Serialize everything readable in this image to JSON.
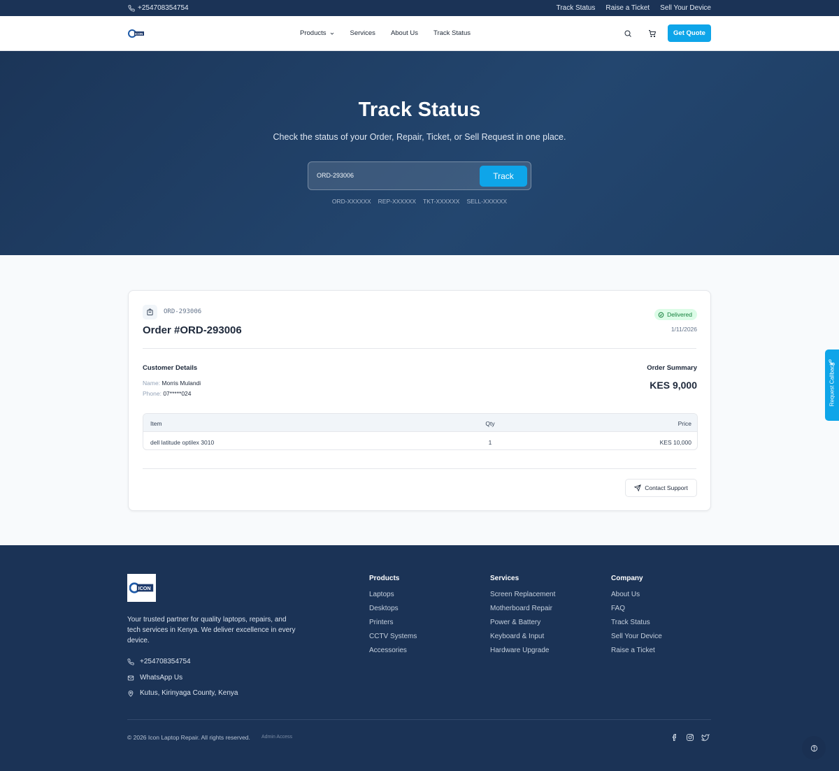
{
  "topbar": {
    "phone": "+254708354754",
    "links": [
      "Track Status",
      "Raise a Ticket",
      "Sell Your Device"
    ]
  },
  "nav": {
    "logo_text": "ICON",
    "menu": [
      "Products",
      "Services",
      "About Us",
      "Track Status"
    ],
    "cta": "Get Quote",
    "icons": [
      "search-icon",
      "cart-icon",
      "chevron-down-icon"
    ]
  },
  "hero": {
    "title": "Track Status",
    "subtitle": "Check the status of your Order, Repair, Ticket, or Sell Request in one place.",
    "input_value": "ORD-293006",
    "button": "Track",
    "formats": [
      "ORD-XXXXXX",
      "REP-XXXXXX",
      "TKT-XXXXXX",
      "SELL-XXXXXX"
    ]
  },
  "order": {
    "code": "ORD-293006",
    "title": "Order #ORD-293006",
    "status": "Delivered",
    "date": "1/11/2026",
    "customer_heading": "Customer Details",
    "name_label": "Name:",
    "name": "Morris Mulandi",
    "phone_label": "Phone:",
    "phone": "07*****024",
    "summary_heading": "Order Summary",
    "total": "KES 9,000",
    "table": {
      "headers": [
        "Item",
        "Qty",
        "Price"
      ],
      "rows": [
        [
          "dell latitude optilex 3010",
          "1",
          "KES 10,000"
        ]
      ]
    },
    "support_button": "Contact Support",
    "status_color": "#15803d"
  },
  "callback": {
    "label": "Request Callback"
  },
  "footer": {
    "logo_text": "ICON",
    "tagline": "Your trusted partner for quality laptops, repairs, and tech services in Kenya. We deliver excellence in every device.",
    "contact": [
      "+254708354754",
      "WhatsApp Us",
      "Kutus, Kirinyaga County, Kenya"
    ],
    "columns": [
      {
        "title": "Products",
        "items": [
          "Laptops",
          "Desktops",
          "Printers",
          "CCTV Systems",
          "Accessories"
        ]
      },
      {
        "title": "Services",
        "items": [
          "Screen Replacement",
          "Motherboard Repair",
          "Power & Battery",
          "Keyboard & Input",
          "Hardware Upgrade"
        ]
      },
      {
        "title": "Company",
        "items": [
          "About Us",
          "FAQ",
          "Track Status",
          "Sell Your Device",
          "Raise a Ticket"
        ]
      }
    ],
    "copyright": "© 2026 Icon Laptop Repair. All rights reserved.",
    "admin": "Admin Access",
    "social": [
      "facebook-icon",
      "instagram-icon",
      "twitter-icon"
    ]
  },
  "colors": {
    "navy": "#1b3356",
    "accent": "#0ea5e9",
    "success_bg": "#dcfce7"
  }
}
